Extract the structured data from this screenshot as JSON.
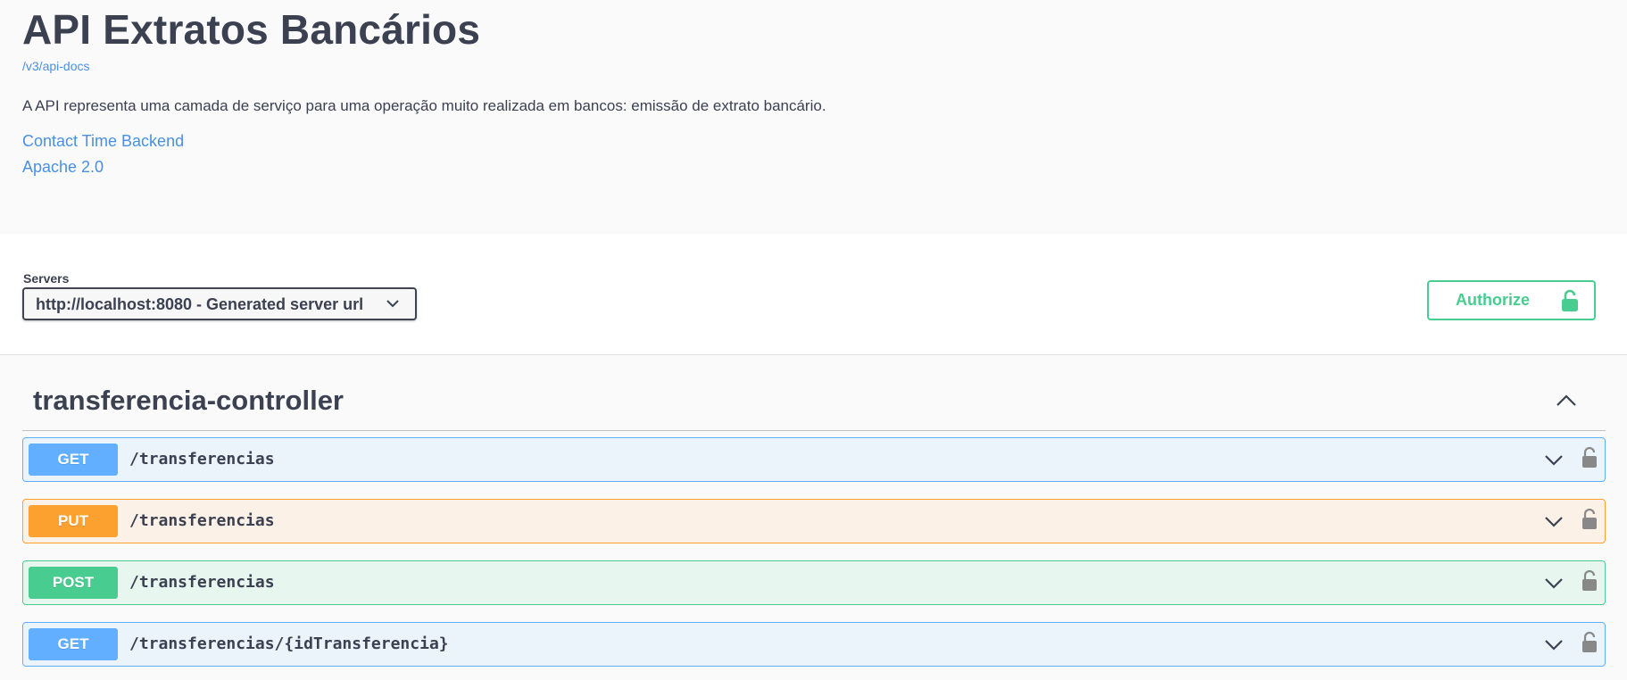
{
  "info": {
    "title": "API Extratos Bancários",
    "api_docs_link": "/v3/api-docs",
    "description": "A API representa uma camada de serviço para uma operação muito realizada em bancos: emissão de extrato bancário.",
    "contact_link": "Contact Time Backend",
    "license_link": "Apache 2.0"
  },
  "servers": {
    "label": "Servers",
    "selected": "http://localhost:8080 - Generated server url"
  },
  "authorize": {
    "label": "Authorize",
    "icon": "unlocked-lock-icon"
  },
  "tag": {
    "name": "transferencia-controller",
    "expanded": true,
    "operations": [
      {
        "method": "GET",
        "path": "/transferencias",
        "color": "#61affe"
      },
      {
        "method": "PUT",
        "path": "/transferencias",
        "color": "#fca130"
      },
      {
        "method": "POST",
        "path": "/transferencias",
        "color": "#49cc90"
      },
      {
        "method": "GET",
        "path": "/transferencias/{idTransferencia}",
        "color": "#61affe"
      }
    ]
  },
  "colors": {
    "text": "#3b4151",
    "link": "#4990e2",
    "get": "#61affe",
    "put": "#fca130",
    "post": "#49cc90"
  }
}
